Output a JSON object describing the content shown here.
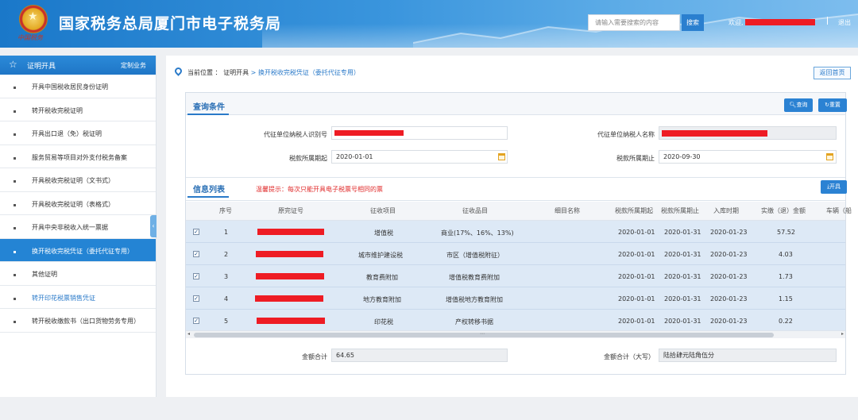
{
  "header": {
    "emblem_text": "中国税务",
    "title": "国家税务总局厦门市电子税务局",
    "search_placeholder": "请输入需要搜索的内容",
    "search_label": "搜索",
    "welcome": "欢迎,",
    "logout": "退出"
  },
  "sidebar": {
    "title": "证明开具",
    "custom": "定制业务",
    "items": [
      {
        "label": "开具中国税收居民身份证明"
      },
      {
        "label": "转开税收完税证明"
      },
      {
        "label": "开具出口退（免）税证明"
      },
      {
        "label": "服务贸易等项目对外支付税务备案"
      },
      {
        "label": "开具税收完税证明（文书式）"
      },
      {
        "label": "开具税收完税证明（表格式）"
      },
      {
        "label": "开具中央非税收入统一票据"
      },
      {
        "label": "换开税收完税凭证（委托代征专用）"
      },
      {
        "label": "其他证明"
      },
      {
        "label": "转开印花税票销售凭证"
      },
      {
        "label": "转开税收缴款书（出口货物劳务专用）"
      }
    ],
    "collapse": "‹"
  },
  "breadcrumb": {
    "label": "当前位置 ：",
    "parent": "证明开具",
    "current": " > 换开税收完税凭证（委托代征专用）"
  },
  "home_button": "返回首页",
  "query": {
    "title": "查询条件",
    "query_btn": "查询",
    "reset_btn": "重置",
    "agent_id_label": "代征单位纳税人识别号",
    "agent_name_label": "代征单位纳税人名称",
    "period_start_label": "税款所属期起",
    "period_start": "2020-01-01",
    "period_end_label": "税款所属期止",
    "period_end": "2020-09-30"
  },
  "list": {
    "title": "信息列表",
    "tip": "温馨提示：每次只能开具电子税票号相同的票",
    "issue_btn": "开具",
    "headers": [
      "序号",
      "原完证号",
      "征收项目",
      "征收品目",
      "细目名称",
      "税款所属期起",
      "税款所属期止",
      "入库时期",
      "实缴（退）金额",
      "车辆（船"
    ],
    "rows": [
      {
        "no": "1",
        "item": "增值税",
        "sub": "商业(17%、16%、13%)",
        "start": "2020-01-01",
        "end": "2020-01-31",
        "date": "2020-01-23",
        "amount": "57.52"
      },
      {
        "no": "2",
        "item": "城市维护建设税",
        "sub": "市区（增值税附征）",
        "start": "2020-01-01",
        "end": "2020-01-31",
        "date": "2020-01-23",
        "amount": "4.03"
      },
      {
        "no": "3",
        "item": "教育费附加",
        "sub": "增值税教育费附加",
        "start": "2020-01-01",
        "end": "2020-01-31",
        "date": "2020-01-23",
        "amount": "1.73"
      },
      {
        "no": "4",
        "item": "地方教育附加",
        "sub": "增值税地方教育附加",
        "start": "2020-01-01",
        "end": "2020-01-31",
        "date": "2020-01-23",
        "amount": "1.15"
      },
      {
        "no": "5",
        "item": "印花税",
        "sub": "产权转移书据",
        "start": "2020-01-01",
        "end": "2020-01-31",
        "date": "2020-01-23",
        "amount": "0.22"
      }
    ],
    "check_mark": "✓"
  },
  "totals": {
    "sum_label": "金额合计",
    "sum": "64.65",
    "sum_cn_label": "金额合计（大写）",
    "sum_cn": "陆拾肆元陆角伍分"
  },
  "colors": {
    "accent": "#2a7ac9",
    "redact": "#ee1c24",
    "row": "#dde9f6"
  }
}
